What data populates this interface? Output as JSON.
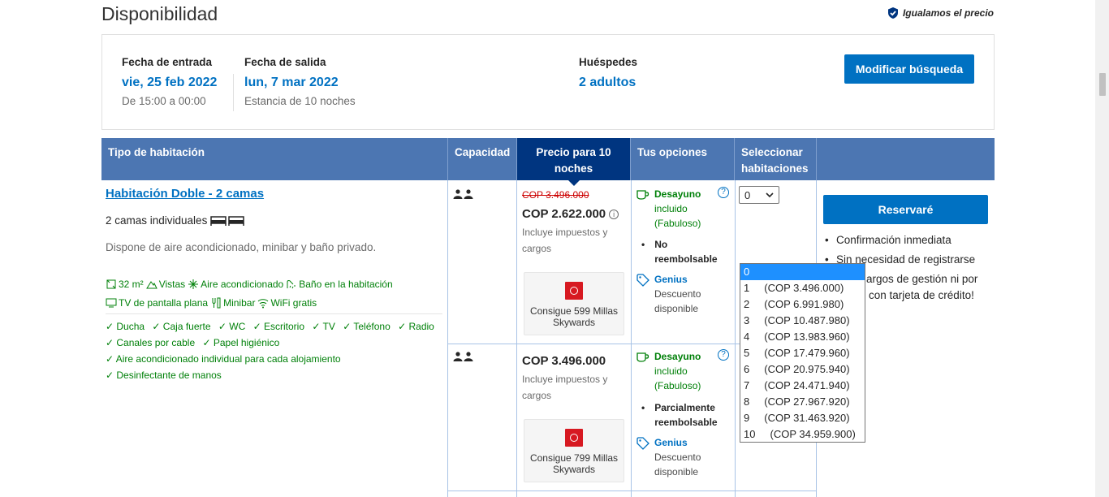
{
  "header": {
    "title": "Disponibilidad",
    "price_match": "Igualamos el precio"
  },
  "summary": {
    "checkin_label": "Fecha de entrada",
    "checkin_date": "vie, 25 feb 2022",
    "checkin_time": "De 15:00 a 00:00",
    "checkout_label": "Fecha de salida",
    "checkout_date": "lun, 7 mar 2022",
    "stay_length": "Estancia de 10 noches",
    "guests_label": "Huéspedes",
    "guests_value": "2 adultos",
    "modify_button": "Modificar búsqueda"
  },
  "table_headers": {
    "room_type": "Tipo de habitación",
    "capacity": "Capacidad",
    "price": "Precio para 10 noches",
    "options": "Tus opciones",
    "select_rooms": "Seleccionar habitaciones"
  },
  "room": {
    "name": "Habitación Doble - 2 camas",
    "beds": "2 camas individuales",
    "description": "Dispone de aire acondicionado, minibar y baño privado.",
    "facilities_row1": [
      "32 m²",
      "Vistas",
      "Aire acondicionado",
      "Baño en la habitación"
    ],
    "facilities_row2": [
      "TV de pantalla plana",
      "Minibar",
      "WiFi gratis"
    ],
    "amenities_row1": [
      "✓ Ducha",
      "✓ Caja fuerte",
      "✓ WC",
      "✓ Escritorio",
      "✓ TV",
      "✓ Teléfono",
      "✓ Radio"
    ],
    "amenities_row2": [
      "✓ Canales por cable",
      "✓ Papel higiénico"
    ],
    "amenities_row3": [
      "✓ Aire acondicionado individual para cada alojamiento"
    ],
    "amenities_row4": [
      "✓ Desinfectante de manos"
    ]
  },
  "offers": [
    {
      "old_price": "COP 3.496.000",
      "price": "COP 2.622.000",
      "price_note": "Incluye impuestos y cargos",
      "skywards": "Consigue 599 Millas Skywards",
      "breakfast_title": "Desayuno",
      "breakfast_desc": "incluido (Fabuloso)",
      "policy": "No reembolsable",
      "genius": "Genius",
      "genius_desc": "Descuento disponible",
      "qty": "0"
    },
    {
      "price": "COP 3.496.000",
      "price_note": "Incluye impuestos y cargos",
      "skywards": "Consigue 799 Millas Skywards",
      "breakfast_title": "Desayuno",
      "breakfast_desc": "incluido (Fabuloso)",
      "policy": "Parcialmente reembolsable",
      "genius": "Genius",
      "genius_desc": "Descuento disponible"
    }
  ],
  "dropdown": {
    "options": [
      "0",
      "1     (COP 3.496.000)",
      "2     (COP 6.991.980)",
      "3     (COP 10.487.980)",
      "4     (COP 13.983.960)",
      "5     (COP 17.479.960)",
      "6     (COP 20.975.940)",
      "7     (COP 24.471.940)",
      "8     (COP 27.967.920)",
      "9     (COP 31.463.920)",
      "10     (COP 34.959.900)"
    ],
    "selected_index": 0
  },
  "reserve": {
    "button": "Reservaré",
    "bullet1": "Confirmación inmediata",
    "bullet2": "Sin necesidad de registrarse",
    "bullet3": "argos de gestión ni por",
    "bullet4": "con tarjeta de crédito!"
  },
  "colors": {
    "brand_blue": "#0071c2",
    "header_blue": "#4c76b2",
    "dark_blue": "#003580",
    "green": "#008009",
    "strike_red": "#cc0000"
  }
}
